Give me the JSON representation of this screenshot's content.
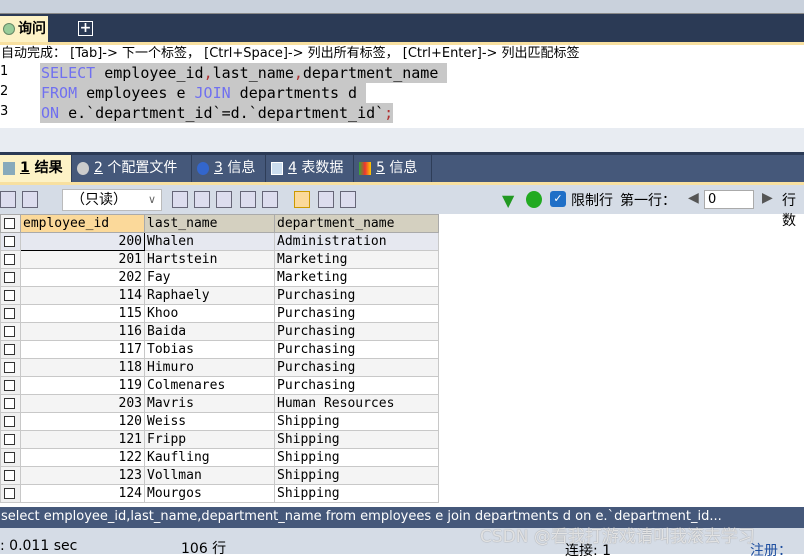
{
  "query_tab": {
    "label": "询问",
    "add_label": "+"
  },
  "hint": "自动完成： [Tab]-> 下一个标签， [Ctrl+Space]-> 列出所有标签， [Ctrl+Enter]-> 列出匹配标签",
  "editor": {
    "line_numbers": [
      "1",
      "2",
      "3"
    ],
    "line1": {
      "kw": "SELECT",
      "a": " employee_id",
      "c1": ",",
      "b": "last_name",
      "c2": ",",
      "c": "department_name "
    },
    "line2": {
      "kw1": "FROM",
      "a": " employees e ",
      "kw2": "JOIN",
      "b": " departments d "
    },
    "line3": {
      "kw": "ON",
      "a": " e.`department_id`=d.`department_id`",
      "semi": ";"
    }
  },
  "result_tabs": [
    {
      "num": "1",
      "label": " 结果",
      "icon": "result-icon"
    },
    {
      "num": "2",
      "label": " 个配置文件",
      "icon": "profile-icon"
    },
    {
      "num": "3",
      "label": " 信息",
      "icon": "info-icon"
    },
    {
      "num": "4",
      "label": " 表数据",
      "icon": "table-icon"
    },
    {
      "num": "5",
      "label": " 信息",
      "icon": "info-chart-icon"
    }
  ],
  "toolbar": {
    "mode": "（只读）",
    "limit_label": "限制行",
    "first_row_label": "第一行：",
    "first_row_value": "0",
    "rows_label": "行数"
  },
  "grid": {
    "columns": [
      "employee_id",
      "last_name",
      "department_name"
    ],
    "rows": [
      [
        "200",
        "Whalen",
        "Administration"
      ],
      [
        "201",
        "Hartstein",
        "Marketing"
      ],
      [
        "202",
        "Fay",
        "Marketing"
      ],
      [
        "114",
        "Raphaely",
        "Purchasing"
      ],
      [
        "115",
        "Khoo",
        "Purchasing"
      ],
      [
        "116",
        "Baida",
        "Purchasing"
      ],
      [
        "117",
        "Tobias",
        "Purchasing"
      ],
      [
        "118",
        "Himuro",
        "Purchasing"
      ],
      [
        "119",
        "Colmenares",
        "Purchasing"
      ],
      [
        "203",
        "Mavris",
        "Human Resources"
      ],
      [
        "120",
        "Weiss",
        "Shipping"
      ],
      [
        "121",
        "Fripp",
        "Shipping"
      ],
      [
        "122",
        "Kaufling",
        "Shipping"
      ],
      [
        "123",
        "Vollman",
        "Shipping"
      ],
      [
        "124",
        "Mourgos",
        "Shipping"
      ]
    ]
  },
  "status": {
    "query": "select employee_id,last_name,department_name from employees e join departments d on e.`department_id...",
    "time": ": 0.011 sec",
    "rows": "106 行",
    "connection": "连接: 1",
    "register": "注册："
  },
  "watermark": "CSDN @看我打游戏请叫我滚去学习",
  "colors": {
    "navy": "#2b3a55",
    "tab_active": "#fdf2c6",
    "keyword": "#7070f0"
  }
}
